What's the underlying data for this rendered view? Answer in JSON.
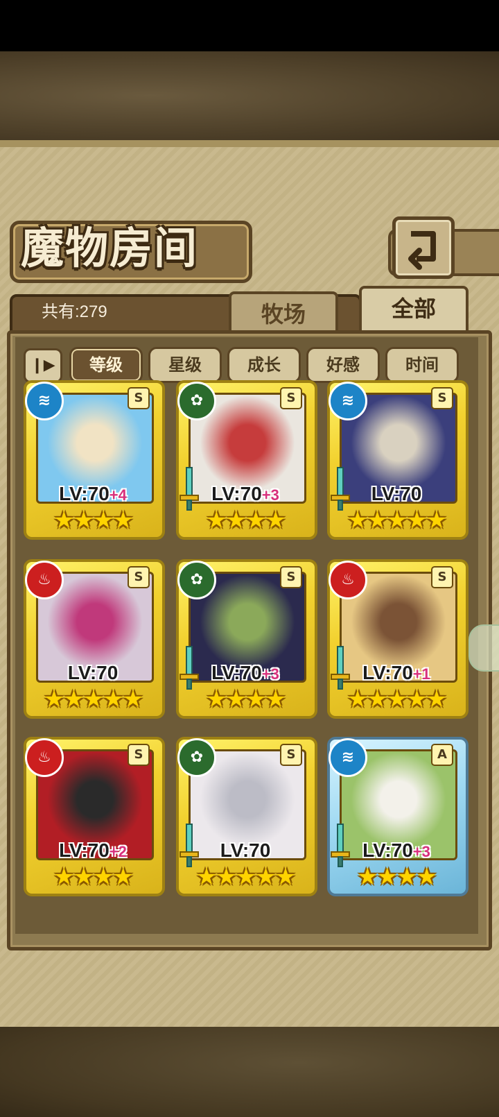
{
  "screen": {
    "title": "魔物房间",
    "count": "共有:279",
    "tabs": {
      "farm": "牧场",
      "all": "全部",
      "active": "all"
    },
    "sort": {
      "toggle_icon": "order-toggle-icon",
      "options": [
        "等级",
        "星级",
        "成长",
        "好感",
        "时间"
      ],
      "active": "等级"
    }
  },
  "monsters": [
    {
      "element": "water",
      "rank": "S",
      "level": "LV:70",
      "plus": "+4",
      "stars": "★★★★",
      "weapon": false,
      "frame": "gold"
    },
    {
      "element": "leaf",
      "rank": "S",
      "level": "LV:70",
      "plus": "+3",
      "stars": "★★★★",
      "weapon": true,
      "frame": "gold"
    },
    {
      "element": "water",
      "rank": "S",
      "level": "LV:70",
      "plus": "",
      "stars": "★★★★★",
      "weapon": true,
      "frame": "gold"
    },
    {
      "element": "fire",
      "rank": "S",
      "level": "LV:70",
      "plus": "",
      "stars": "★★★★★",
      "weapon": false,
      "frame": "gold"
    },
    {
      "element": "leaf",
      "rank": "S",
      "level": "LV:70",
      "plus": "+3",
      "stars": "★★★★",
      "weapon": true,
      "frame": "gold"
    },
    {
      "element": "fire",
      "rank": "S",
      "level": "LV:70",
      "plus": "+1",
      "stars": "★★★★★",
      "weapon": true,
      "frame": "gold"
    },
    {
      "element": "fire",
      "rank": "S",
      "level": "LV:70",
      "plus": "+2",
      "stars": "★★★★",
      "weapon": false,
      "frame": "gold"
    },
    {
      "element": "leaf",
      "rank": "S",
      "level": "LV:70",
      "plus": "",
      "stars": "★★★★★",
      "weapon": true,
      "frame": "gold"
    },
    {
      "element": "water",
      "rank": "A",
      "level": "LV:70",
      "plus": "+3",
      "stars": "★★★★",
      "weapon": true,
      "frame": "blue"
    }
  ],
  "colors": {
    "water": "#1d84c7",
    "leaf": "#2b6b2d",
    "fire": "#cc1f1f",
    "plus": "#d8307c"
  }
}
